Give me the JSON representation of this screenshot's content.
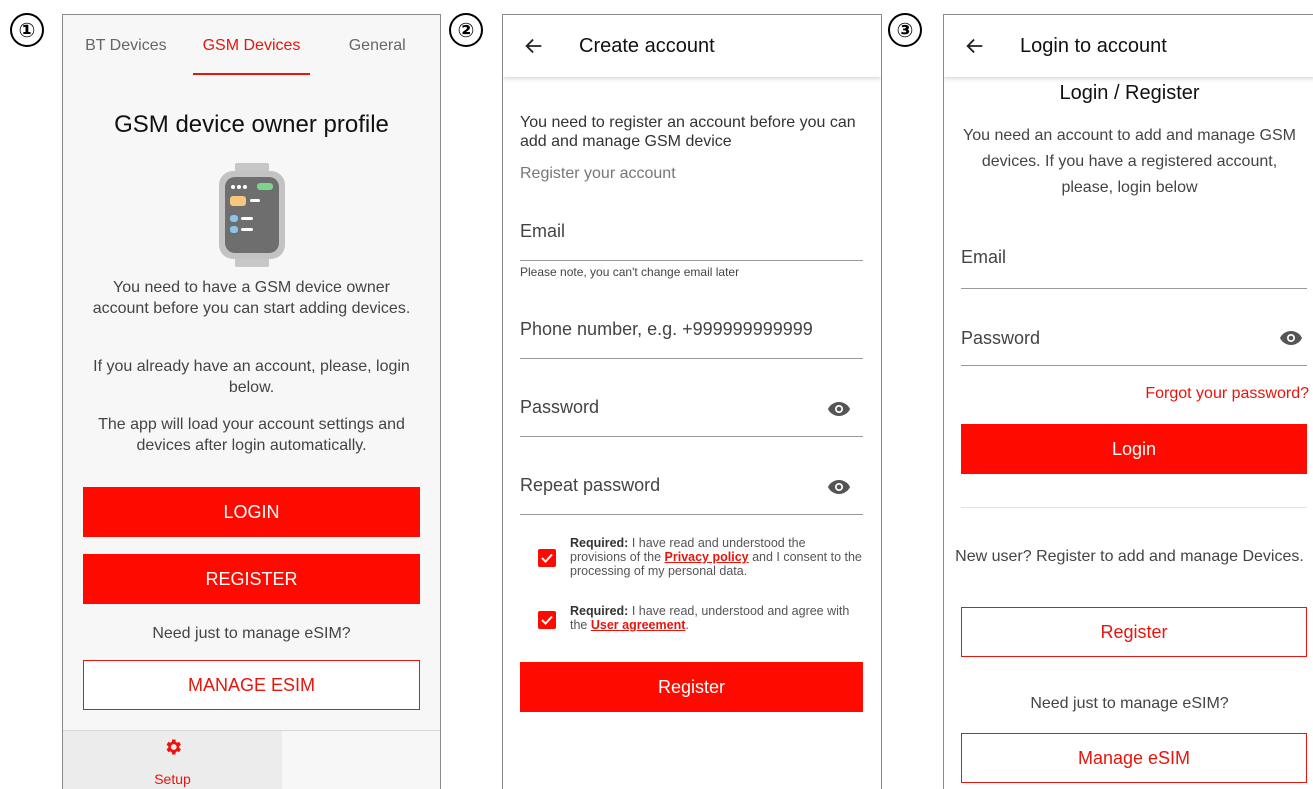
{
  "markers": [
    "①",
    "②",
    "③"
  ],
  "panel1": {
    "tabs": [
      {
        "label": "BT Devices",
        "active": false
      },
      {
        "label": "GSM Devices",
        "active": true
      },
      {
        "label": "General",
        "active": false
      }
    ],
    "title": "GSM device owner profile",
    "icon": "smartwatch-icon",
    "paragraphs": [
      "You need to have a GSM device owner account before you can start adding devices.",
      "If you already have an account, please, login below.",
      "The app will load your account settings and devices after login automatically."
    ],
    "login_button": "LOGIN",
    "register_button": "REGISTER",
    "esim_prompt": "Need just to manage eSIM?",
    "manage_esim_button": "MANAGE ESIM",
    "bottom_nav": {
      "label": "Setup",
      "icon": "gear-icon"
    }
  },
  "panel2": {
    "title": "Create account",
    "intro": "You need to register an account before you can add and manage GSM device",
    "subheading": "Register your account",
    "email_label": "Email",
    "email_hint": "Please note, you can't change email later",
    "phone_label": "Phone number, e.g. +999999999999",
    "password_label": "Password",
    "repeat_password_label": "Repeat password",
    "consent1": {
      "required": "Required:",
      "before": "I have read and understood the provisions of the",
      "link": "Privacy policy",
      "after": "and I consent to the processing of my personal data.",
      "checked": true
    },
    "consent2": {
      "required": "Required:",
      "before": "I have read, understood and agree with the",
      "link": "User agreement",
      "after": ".",
      "checked": true
    },
    "register_button": "Register"
  },
  "panel3": {
    "title": "Login to account",
    "heading": "Login / Register",
    "intro": "You need an account to add and manage GSM devices. If you have a registered account, please, login below",
    "email_label": "Email",
    "password_label": "Password",
    "forgot_link": "Forgot your password?",
    "login_button": "Login",
    "new_user_text": "New user? Register to add and manage Devices.",
    "register_button": "Register",
    "esim_prompt": "Need just to manage eSIM?",
    "manage_esim_button": "Manage eSIM"
  },
  "colors": {
    "accent": "#ff0a00",
    "accent_text": "#e8150c"
  }
}
